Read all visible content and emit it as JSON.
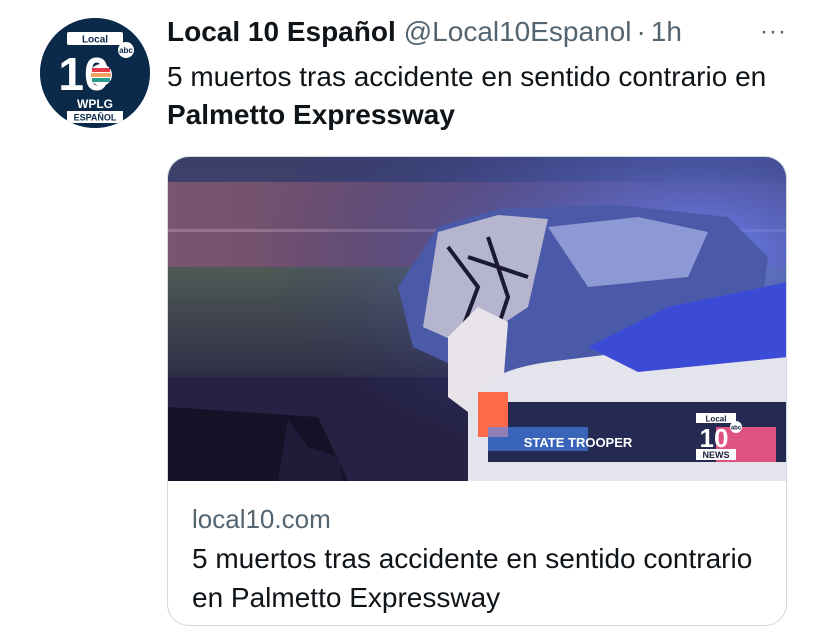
{
  "tweet": {
    "display_name": "Local 10 Español",
    "handle": "@Local10Espanol",
    "separator": "·",
    "time": "1h",
    "more": "···",
    "text_part1": "5 muertos tras accidente en sentido contrario en ",
    "text_bold": "Palmetto Expressway",
    "avatar": {
      "top_label": "Local",
      "number": "10",
      "network": "abc",
      "station": "WPLG",
      "language": "ESPAÑOL"
    }
  },
  "card": {
    "domain": "local10.com",
    "title": "5 muertos tras accidente en sentido contrario en Palmetto Expressway",
    "image": {
      "car_text": "STATE TROOPER",
      "watermark": {
        "top": "Local",
        "number": "10",
        "network": "abc",
        "bottom": "NEWS"
      }
    }
  },
  "colors": {
    "text": "#0f1419",
    "secondary": "#536471",
    "border": "#cfd9de",
    "avatar_bg": "#0b2a4a"
  }
}
